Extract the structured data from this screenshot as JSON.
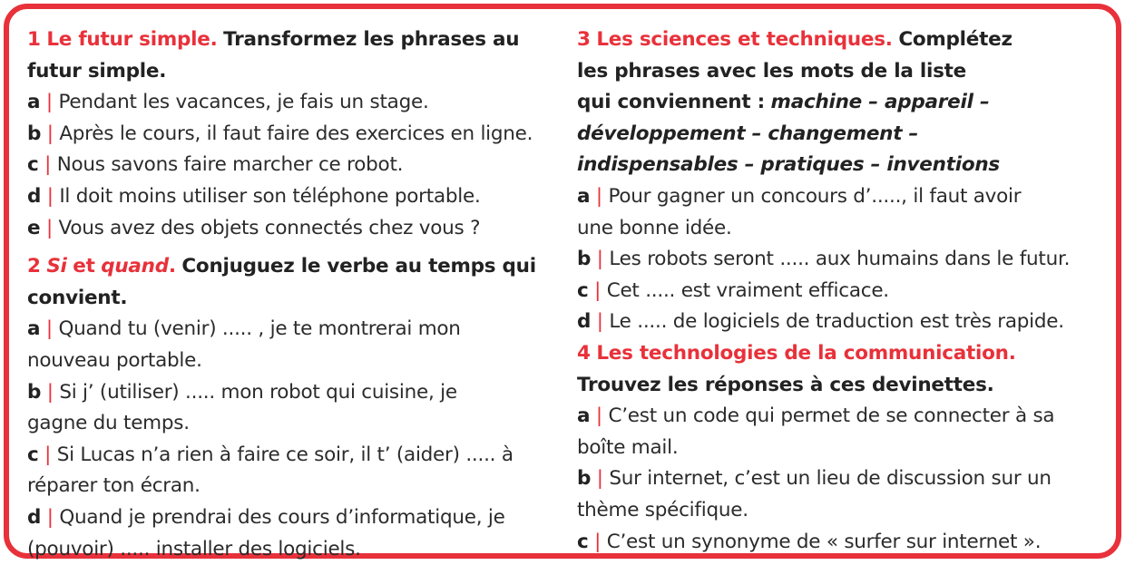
{
  "accent_color": "#e8313a",
  "exercises": {
    "ex1": {
      "number": "1",
      "heading": "Le futur simple.",
      "instruction_l1": "Transformez les phrases au",
      "instruction_l2": "futur simple.",
      "items": [
        {
          "letter": "a",
          "text": "Pendant les vacances, je fais un stage."
        },
        {
          "letter": "b",
          "text": "Après le cours, il faut faire des exercices en ligne."
        },
        {
          "letter": "c",
          "text": "Nous savons faire marcher ce robot."
        },
        {
          "letter": "d",
          "text": "Il doit moins utiliser son téléphone portable."
        },
        {
          "letter": "e",
          "text": "Vous avez des objets connectés chez vous ?"
        }
      ]
    },
    "ex2": {
      "number": "2",
      "heading_si": "Si",
      "heading_et": "et",
      "heading_quand": "quand",
      "heading_dot": ".",
      "instruction_l1": "Conjuguez le verbe au temps qui",
      "instruction_l2": "convient.",
      "items": [
        {
          "letter": "a",
          "l1": "Quand tu (venir) ..... , je te montrerai mon",
          "l2": "nouveau portable."
        },
        {
          "letter": "b",
          "l1": "Si j’ (utiliser) ..... mon robot qui cuisine, je",
          "l2": "gagne du temps."
        },
        {
          "letter": "c",
          "l1": "Si Lucas n’a rien à faire ce soir, il t’ (aider) ..... à",
          "l2": "réparer ton écran."
        },
        {
          "letter": "d",
          "l1": "Quand je prendrai des cours d’informatique, je",
          "l2": "(pouvoir) ..... installer des logiciels."
        }
      ]
    },
    "ex3": {
      "number": "3",
      "heading": "Les sciences et techniques.",
      "instruction_l1": "Complétez",
      "instruction_l2": "les phrases avec les mots de la liste",
      "instruction_l3": "qui conviennent :",
      "words_l3": "machine – appareil –",
      "words_l4": "développement – changement –",
      "words_l5": "indispensables – pratiques – inventions",
      "items": [
        {
          "letter": "a",
          "l1": "Pour gagner un concours d’....., il faut avoir",
          "l2": "une bonne idée."
        },
        {
          "letter": "b",
          "l1": "Les robots seront ..... aux humains dans le futur."
        },
        {
          "letter": "c",
          "l1": "Cet ..... est vraiment efficace."
        },
        {
          "letter": "d",
          "l1": "Le ..... de logiciels de traduction est très rapide."
        }
      ]
    },
    "ex4": {
      "number": "4",
      "heading": "Les technologies de la communication.",
      "instruction": "Trouvez les réponses à ces devinettes.",
      "items": [
        {
          "letter": "a",
          "l1": "C’est un code qui permet de se connecter à sa",
          "l2": "boîte mail."
        },
        {
          "letter": "b",
          "l1": "Sur internet, c’est un lieu de discussion sur un",
          "l2": "thème spécifique."
        },
        {
          "letter": "c",
          "l1": "C’est un synonyme de « surfer sur internet »."
        }
      ]
    }
  }
}
